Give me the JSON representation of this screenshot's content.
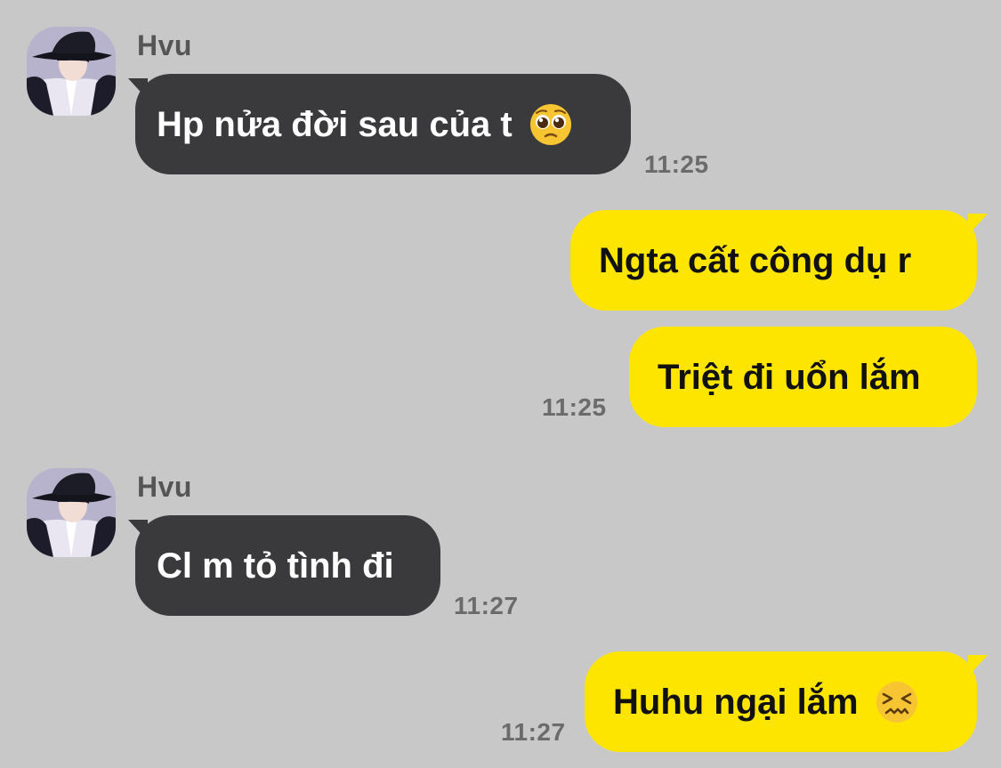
{
  "chat": {
    "messages": [
      {
        "sender": "Hvu",
        "text": "Hp nửa đời sau của t",
        "emoji_icon": "pleading-face-icon",
        "time": "11:25",
        "direction": "incoming"
      },
      {
        "text": "Ngta cất công dụ r",
        "direction": "outgoing"
      },
      {
        "text": "Triệt đi uổn lắm",
        "time": "11:25",
        "direction": "outgoing"
      },
      {
        "sender": "Hvu",
        "text": "Cl m tỏ tình đi",
        "time": "11:27",
        "direction": "incoming"
      },
      {
        "text": "Huhu ngại lắm",
        "emoji_icon": "confounded-face-icon",
        "time": "11:27",
        "direction": "outgoing"
      }
    ]
  },
  "colors": {
    "background": "#c8c8c8",
    "incoming_bubble": "#3a3a3c",
    "outgoing_bubble": "#fee500",
    "timestamp": "#6b6b6b",
    "sender_name": "#555555"
  }
}
